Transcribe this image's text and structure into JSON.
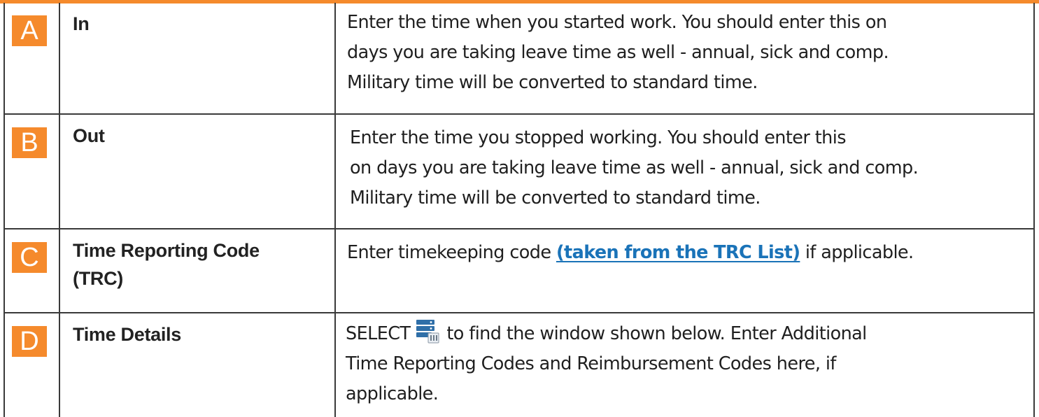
{
  "colors": {
    "accent": "#f58a2c",
    "link": "#1a73b8",
    "border": "#3a3a3a"
  },
  "rows": [
    {
      "letter": "A",
      "field": "In",
      "description_lines": [
        "Enter the time when you started work. You should enter this on",
        "days you are taking leave time as well - annual, sick and comp.",
        "Military time will be converted to standard time."
      ]
    },
    {
      "letter": "B",
      "field": "Out",
      "description_lines": [
        "Enter the time you stopped working. You should enter this",
        "on days you are taking leave time as well - annual, sick and comp.",
        "Military time will be converted to standard time."
      ]
    },
    {
      "letter": "C",
      "field_lines": [
        "Time Reporting Code",
        "(TRC)"
      ],
      "description_before_link": "Enter timekeeping code ",
      "description_link": "(taken from the TRC List)",
      "description_after_link": " if applicable."
    },
    {
      "letter": "D",
      "field": "Time Details",
      "description_before_icon": "SELECT",
      "description_icon": "time-details-icon",
      "description_after_icon": "to find the window shown below. Enter Additional",
      "description_lines": [
        "Time Reporting Codes and Reimbursement Codes here, if",
        "applicable."
      ]
    }
  ]
}
